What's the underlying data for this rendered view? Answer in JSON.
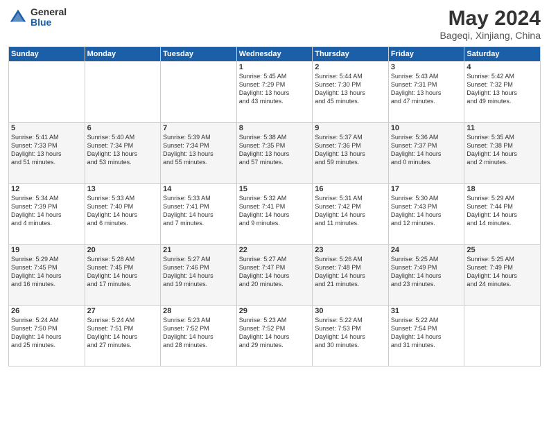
{
  "header": {
    "logo_general": "General",
    "logo_blue": "Blue",
    "month": "May 2024",
    "location": "Bageqi, Xinjiang, China"
  },
  "days_of_week": [
    "Sunday",
    "Monday",
    "Tuesday",
    "Wednesday",
    "Thursday",
    "Friday",
    "Saturday"
  ],
  "weeks": [
    [
      {
        "day": "",
        "info": ""
      },
      {
        "day": "",
        "info": ""
      },
      {
        "day": "",
        "info": ""
      },
      {
        "day": "1",
        "info": "Sunrise: 5:45 AM\nSunset: 7:29 PM\nDaylight: 13 hours\nand 43 minutes."
      },
      {
        "day": "2",
        "info": "Sunrise: 5:44 AM\nSunset: 7:30 PM\nDaylight: 13 hours\nand 45 minutes."
      },
      {
        "day": "3",
        "info": "Sunrise: 5:43 AM\nSunset: 7:31 PM\nDaylight: 13 hours\nand 47 minutes."
      },
      {
        "day": "4",
        "info": "Sunrise: 5:42 AM\nSunset: 7:32 PM\nDaylight: 13 hours\nand 49 minutes."
      }
    ],
    [
      {
        "day": "5",
        "info": "Sunrise: 5:41 AM\nSunset: 7:33 PM\nDaylight: 13 hours\nand 51 minutes."
      },
      {
        "day": "6",
        "info": "Sunrise: 5:40 AM\nSunset: 7:34 PM\nDaylight: 13 hours\nand 53 minutes."
      },
      {
        "day": "7",
        "info": "Sunrise: 5:39 AM\nSunset: 7:34 PM\nDaylight: 13 hours\nand 55 minutes."
      },
      {
        "day": "8",
        "info": "Sunrise: 5:38 AM\nSunset: 7:35 PM\nDaylight: 13 hours\nand 57 minutes."
      },
      {
        "day": "9",
        "info": "Sunrise: 5:37 AM\nSunset: 7:36 PM\nDaylight: 13 hours\nand 59 minutes."
      },
      {
        "day": "10",
        "info": "Sunrise: 5:36 AM\nSunset: 7:37 PM\nDaylight: 14 hours\nand 0 minutes."
      },
      {
        "day": "11",
        "info": "Sunrise: 5:35 AM\nSunset: 7:38 PM\nDaylight: 14 hours\nand 2 minutes."
      }
    ],
    [
      {
        "day": "12",
        "info": "Sunrise: 5:34 AM\nSunset: 7:39 PM\nDaylight: 14 hours\nand 4 minutes."
      },
      {
        "day": "13",
        "info": "Sunrise: 5:33 AM\nSunset: 7:40 PM\nDaylight: 14 hours\nand 6 minutes."
      },
      {
        "day": "14",
        "info": "Sunrise: 5:33 AM\nSunset: 7:41 PM\nDaylight: 14 hours\nand 7 minutes."
      },
      {
        "day": "15",
        "info": "Sunrise: 5:32 AM\nSunset: 7:41 PM\nDaylight: 14 hours\nand 9 minutes."
      },
      {
        "day": "16",
        "info": "Sunrise: 5:31 AM\nSunset: 7:42 PM\nDaylight: 14 hours\nand 11 minutes."
      },
      {
        "day": "17",
        "info": "Sunrise: 5:30 AM\nSunset: 7:43 PM\nDaylight: 14 hours\nand 12 minutes."
      },
      {
        "day": "18",
        "info": "Sunrise: 5:29 AM\nSunset: 7:44 PM\nDaylight: 14 hours\nand 14 minutes."
      }
    ],
    [
      {
        "day": "19",
        "info": "Sunrise: 5:29 AM\nSunset: 7:45 PM\nDaylight: 14 hours\nand 16 minutes."
      },
      {
        "day": "20",
        "info": "Sunrise: 5:28 AM\nSunset: 7:45 PM\nDaylight: 14 hours\nand 17 minutes."
      },
      {
        "day": "21",
        "info": "Sunrise: 5:27 AM\nSunset: 7:46 PM\nDaylight: 14 hours\nand 19 minutes."
      },
      {
        "day": "22",
        "info": "Sunrise: 5:27 AM\nSunset: 7:47 PM\nDaylight: 14 hours\nand 20 minutes."
      },
      {
        "day": "23",
        "info": "Sunrise: 5:26 AM\nSunset: 7:48 PM\nDaylight: 14 hours\nand 21 minutes."
      },
      {
        "day": "24",
        "info": "Sunrise: 5:25 AM\nSunset: 7:49 PM\nDaylight: 14 hours\nand 23 minutes."
      },
      {
        "day": "25",
        "info": "Sunrise: 5:25 AM\nSunset: 7:49 PM\nDaylight: 14 hours\nand 24 minutes."
      }
    ],
    [
      {
        "day": "26",
        "info": "Sunrise: 5:24 AM\nSunset: 7:50 PM\nDaylight: 14 hours\nand 25 minutes."
      },
      {
        "day": "27",
        "info": "Sunrise: 5:24 AM\nSunset: 7:51 PM\nDaylight: 14 hours\nand 27 minutes."
      },
      {
        "day": "28",
        "info": "Sunrise: 5:23 AM\nSunset: 7:52 PM\nDaylight: 14 hours\nand 28 minutes."
      },
      {
        "day": "29",
        "info": "Sunrise: 5:23 AM\nSunset: 7:52 PM\nDaylight: 14 hours\nand 29 minutes."
      },
      {
        "day": "30",
        "info": "Sunrise: 5:22 AM\nSunset: 7:53 PM\nDaylight: 14 hours\nand 30 minutes."
      },
      {
        "day": "31",
        "info": "Sunrise: 5:22 AM\nSunset: 7:54 PM\nDaylight: 14 hours\nand 31 minutes."
      },
      {
        "day": "",
        "info": ""
      }
    ]
  ]
}
